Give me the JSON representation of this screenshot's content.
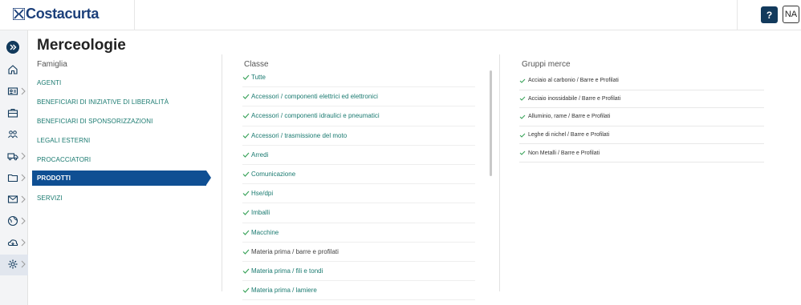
{
  "brand": {
    "name": "Costacurta"
  },
  "header": {
    "help_label": "?",
    "user_initials": "NA"
  },
  "sidebar": {
    "items": [
      {
        "icon": "expand-icon"
      },
      {
        "icon": "home-icon"
      },
      {
        "icon": "id-card-icon"
      },
      {
        "icon": "briefcase-icon"
      },
      {
        "icon": "people-icon"
      },
      {
        "icon": "truck-icon"
      },
      {
        "icon": "folder-icon"
      },
      {
        "icon": "mail-icon"
      },
      {
        "icon": "globe-icon"
      },
      {
        "icon": "cloud-download-icon"
      },
      {
        "icon": "gear-icon"
      }
    ]
  },
  "page": {
    "title": "Merceologie"
  },
  "famiglia": {
    "header": "Famiglia",
    "items": [
      "AGENTI",
      "BENEFICIARI DI INIZIATIVE DI LIBERALITÀ",
      "BENEFICIARI DI SPONSORIZZAZIONI",
      "LEGALI ESTERNI",
      "PROCACCIATORI",
      "PRODOTTI",
      "SERVIZI"
    ],
    "selected": "PRODOTTI"
  },
  "classe": {
    "header": "Classe",
    "items": [
      "Tutte",
      "Accessori / componenti elettrici ed elettronici",
      "Accessori / componenti idraulici e pneumatici",
      "Accessori / trasmissione del moto",
      "Arredi",
      "Comunicazione",
      "Hse/dpi",
      "Imballi",
      "Macchine",
      "Materia prima / barre e profilati",
      "Materia prima / fili e tondi",
      "Materia prima / lamiere"
    ]
  },
  "gruppi": {
    "header": "Gruppi merce",
    "items": [
      "Acciaio al carbonio / Barre e Profilati",
      "Acciaio inossidabile / Barre e Profilati",
      "Alluminio, rame / Barre e Profilati",
      "Leghe di nichel / Barre e Profilati",
      "Non Metalli / Barre e Profilati"
    ]
  },
  "colors": {
    "accent": "#0f4f93",
    "link": "#1a7a70",
    "dark": "#123a5c",
    "check": "#3aa35a"
  }
}
